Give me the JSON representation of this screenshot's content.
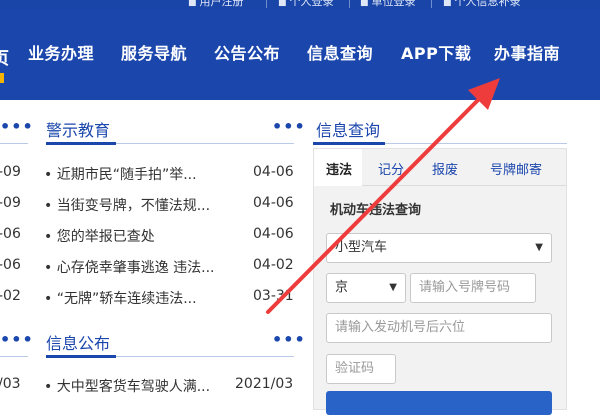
{
  "top_links": [
    {
      "label": "用户注册",
      "icon": "user-plus-icon"
    },
    {
      "label": "个人登录",
      "icon": "user-icon"
    },
    {
      "label": "单位登录",
      "icon": "building-icon"
    },
    {
      "label": "个人信息补录",
      "icon": "person-icon"
    }
  ],
  "nav": {
    "left_partial": "页",
    "items": [
      "业务办理",
      "服务导航",
      "公告公布",
      "信息查询",
      "APP下载",
      "办事指南"
    ]
  },
  "warning_section": {
    "title": "警示教育",
    "more": "•••",
    "items": [
      {
        "text": "• 近期市民“随手拍”举...",
        "date": "04-06"
      },
      {
        "text": "• 当街变号牌，不懂法规...",
        "date": "04-06"
      },
      {
        "text": "• 您的举报已查处",
        "date": "04-06"
      },
      {
        "text": "• 心存侥幸肇事逃逸 违法...",
        "date": "04-02"
      },
      {
        "text": "• “无牌”轿车连续违法...",
        "date": "03-31"
      }
    ]
  },
  "left_partial_dates": [
    "-09",
    "-09",
    "-06",
    "-06",
    "-02"
  ],
  "left_more": "•••",
  "left_bottom_date": "/03",
  "info_section": {
    "title": "信息公布",
    "more": "•••",
    "items": [
      {
        "text": "• 大中型客货车驾驶人满...",
        "date": "2021/03"
      }
    ]
  },
  "query_panel": {
    "title": "信息查询",
    "tabs": [
      "违法",
      "记分",
      "报废",
      "号牌邮寄"
    ],
    "active_tab": "违法",
    "subheading": "机动车违法查询",
    "vehicle_type": "小型汽车",
    "province": "京",
    "plate_placeholder": "请输入号牌号码",
    "engine_placeholder": "请输入发动机号后六位",
    "captcha_placeholder": "验证码"
  },
  "colors": {
    "nav_bg": "#1b47ad",
    "accent": "#1b47ad",
    "arrow": "#ee3b3b"
  }
}
